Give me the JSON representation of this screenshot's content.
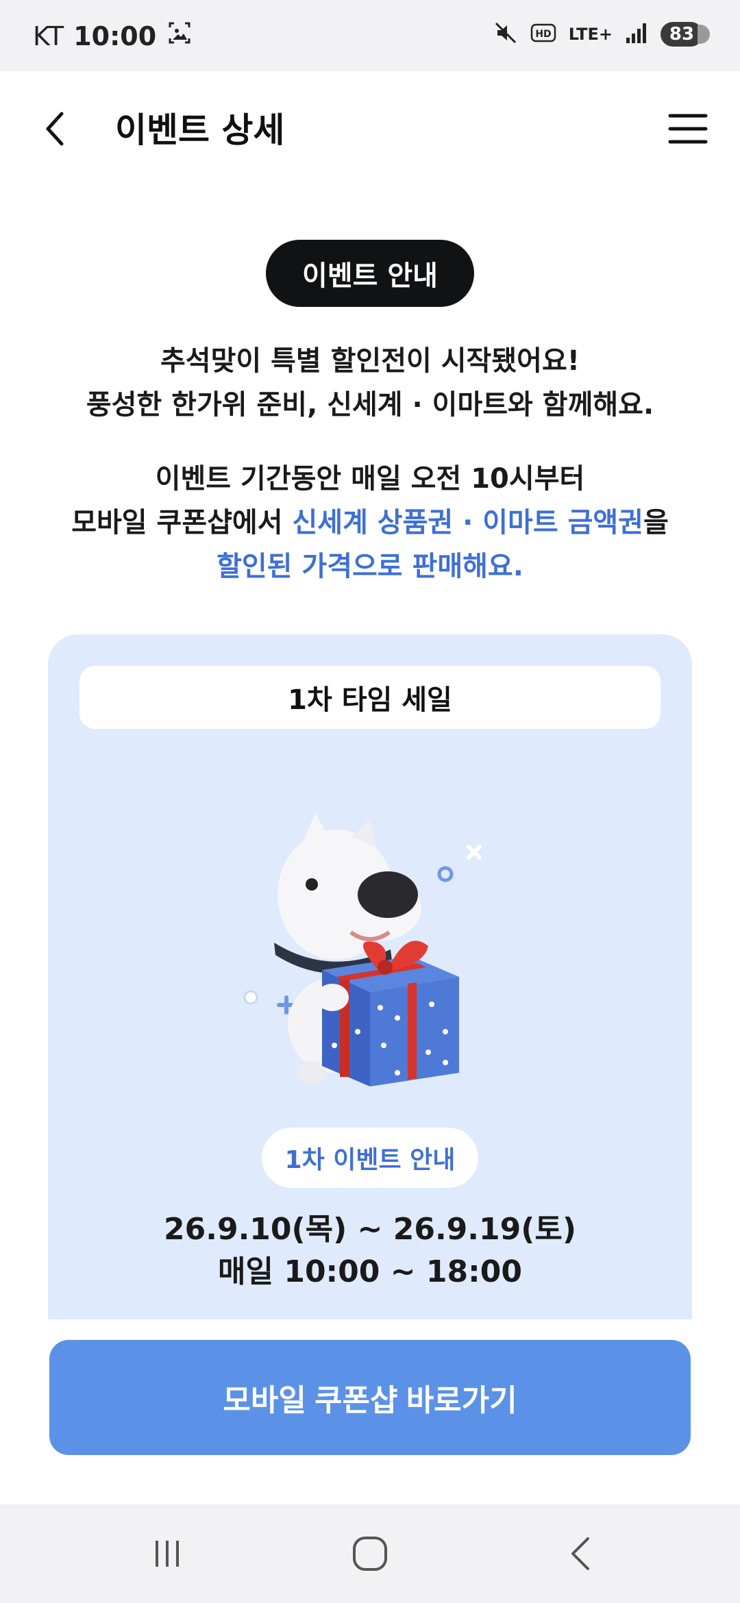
{
  "status_bar": {
    "carrier": "KT",
    "time": "10:00",
    "network": "LTE+",
    "battery": "83",
    "icons": [
      "screenshot-icon",
      "mute-icon",
      "hd-icon",
      "lte-icon",
      "signal-icon",
      "battery-icon"
    ]
  },
  "header": {
    "title": "이벤트 상세",
    "back_icon": "chevron-left-icon",
    "menu_icon": "hamburger-menu-icon"
  },
  "event": {
    "badge": "이벤트 안내",
    "intro_line1": "추석맞이 특별 할인전이 시작됐어요!",
    "intro_line2": "풍성한 한가위 준비, 신세계 · 이마트와 함께해요.",
    "detail_line1": "이벤트 기간동안 매일 오전 10시부터",
    "detail_line2_pre": "모바일 쿠폰샵에서 ",
    "detail_line2_highlight": "신세계 상품권 · 이마트 금액권",
    "detail_line2_post": "을",
    "detail_line3_highlight": "할인된 가격으로 판매해요."
  },
  "sale_card": {
    "round_title": "1차 타임 세일",
    "illustration": "dog-mascot-with-gift-box",
    "info_chip": "1차 이벤트 안내",
    "dates": "26.9.10(목) ~ 26.9.19(토)",
    "hours": "매일 10:00 ~ 18:00"
  },
  "cta": {
    "label": "모바일 쿠폰샵 바로가기"
  },
  "nav": {
    "recents_icon": "recent-apps-icon",
    "home_icon": "home-icon",
    "back_icon": "back-icon"
  },
  "colors": {
    "accent": "#3e6fd6",
    "cta": "#5b92e8",
    "card_bg": "#dfeafc",
    "badge_bg": "#111214"
  }
}
